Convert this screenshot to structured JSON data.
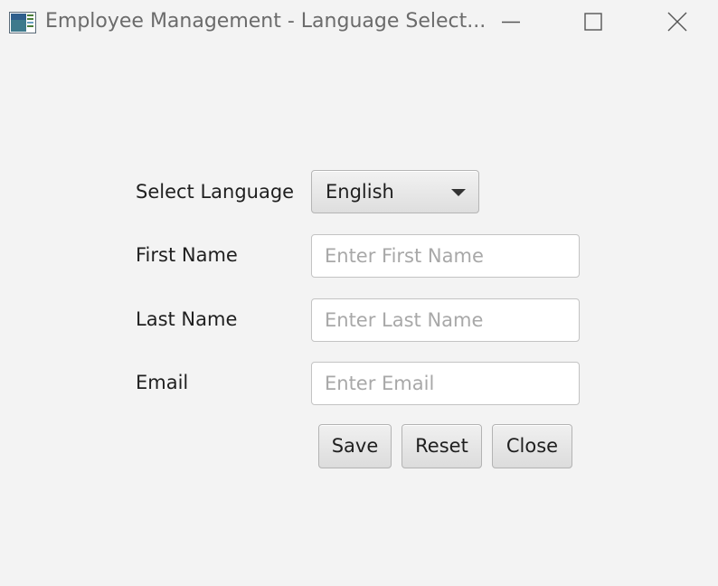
{
  "window": {
    "title": "Employee Management - Language Select...",
    "controls": {
      "minimize_icon": "minimize-icon",
      "maximize_icon": "maximize-icon",
      "close_icon": "close-icon"
    }
  },
  "form": {
    "language": {
      "label": "Select Language",
      "selected": "English"
    },
    "first_name": {
      "label": "First Name",
      "value": "",
      "placeholder": "Enter First Name"
    },
    "last_name": {
      "label": "Last Name",
      "value": "",
      "placeholder": "Enter Last Name"
    },
    "email": {
      "label": "Email",
      "value": "",
      "placeholder": "Enter Email"
    }
  },
  "buttons": {
    "save": "Save",
    "reset": "Reset",
    "close": "Close"
  }
}
